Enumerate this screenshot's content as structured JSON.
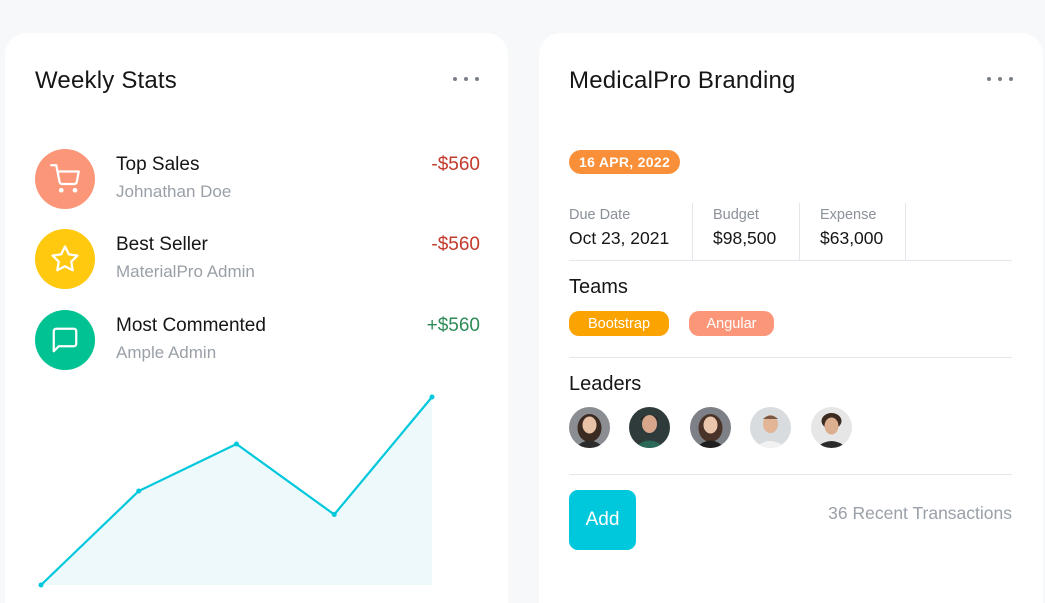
{
  "weekly_stats": {
    "title": "Weekly Stats",
    "items": [
      {
        "title": "Top Sales",
        "subtitle": "Johnathan Doe",
        "amount": "-$560",
        "icon": "cart-icon",
        "color": "#fb9678"
      },
      {
        "title": "Best Seller",
        "subtitle": "MaterialPro Admin",
        "amount": "-$560",
        "icon": "star-icon",
        "color": "#fec90f"
      },
      {
        "title": "Most Commented",
        "subtitle": "Ample Admin",
        "amount": "+$560",
        "icon": "chat-icon",
        "color": "#00c292"
      }
    ],
    "chart_data": {
      "type": "area",
      "x": [
        1,
        2,
        3,
        4,
        5
      ],
      "series": [
        {
          "values": [
            0,
            40,
            60,
            30,
            80
          ]
        }
      ],
      "ylim": [
        0,
        80
      ],
      "grid": false,
      "colors": {
        "line": "#00c8dc",
        "fill": "#eef9fb"
      }
    }
  },
  "medical": {
    "title": "MedicalPro Branding",
    "date_badge": "16 APR, 2022",
    "info": [
      {
        "label": "Due Date",
        "value": "Oct 23, 2021"
      },
      {
        "label": "Budget",
        "value": "$98,500"
      },
      {
        "label": "Expense",
        "value": "$63,000"
      }
    ],
    "teams_title": "Teams",
    "teams": [
      {
        "label": "Bootstrap",
        "color": "#fba300"
      },
      {
        "label": "Angular",
        "color": "#fb9678"
      }
    ],
    "leaders_title": "Leaders",
    "leaders": [
      "avatar-1",
      "avatar-2",
      "avatar-3",
      "avatar-4",
      "avatar-5"
    ],
    "add_label": "Add",
    "transactions": "36 Recent Transactions"
  }
}
